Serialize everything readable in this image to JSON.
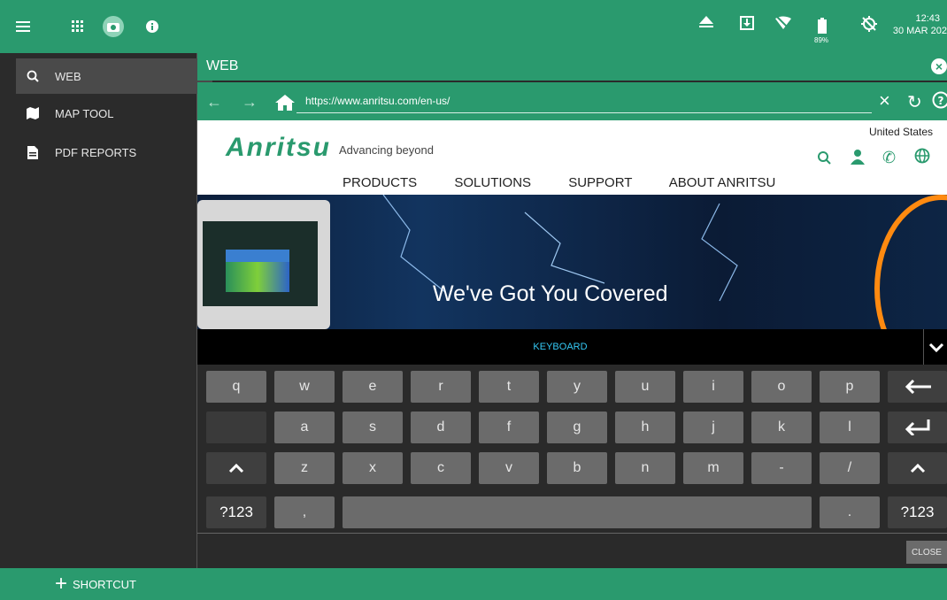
{
  "topbar": {
    "icons": [
      "menu-icon",
      "apps-grid-icon",
      "camera-icon",
      "info-icon"
    ],
    "status": {
      "battery_pct": "89%",
      "time": "12:43",
      "date": "30 MAR 202"
    }
  },
  "sidebar": {
    "items": [
      {
        "label": "WEB",
        "icon": "globe-search-icon",
        "active": true
      },
      {
        "label": "MAP TOOL",
        "icon": "map-icon",
        "active": false
      },
      {
        "label": "PDF REPORTS",
        "icon": "document-icon",
        "active": false
      }
    ]
  },
  "bottombar": {
    "shortcut_label": "SHORTCUT"
  },
  "web": {
    "title": "WEB",
    "url": "https://www.anritsu.com/en-us/",
    "page": {
      "logo": "Anritsu",
      "tagline": "Advancing beyond",
      "country": "United States",
      "nav": [
        "PRODUCTS",
        "SOLUTIONS",
        "SUPPORT",
        "ABOUT ANRITSU"
      ],
      "hero_title": "We've Got You Covered"
    }
  },
  "keyboard": {
    "title": "KEYBOARD",
    "row1": [
      "q",
      "w",
      "e",
      "r",
      "t",
      "y",
      "u",
      "i",
      "o",
      "p"
    ],
    "row2": [
      "a",
      "s",
      "d",
      "f",
      "g",
      "h",
      "j",
      "k",
      "l"
    ],
    "row3": [
      "z",
      "x",
      "c",
      "v",
      "b",
      "n",
      "m",
      "-",
      "/"
    ],
    "row4": {
      "sym_left": "?123",
      "comma": ",",
      "period": ".",
      "sym_right": "?123"
    },
    "close_label": "CLOSE"
  }
}
